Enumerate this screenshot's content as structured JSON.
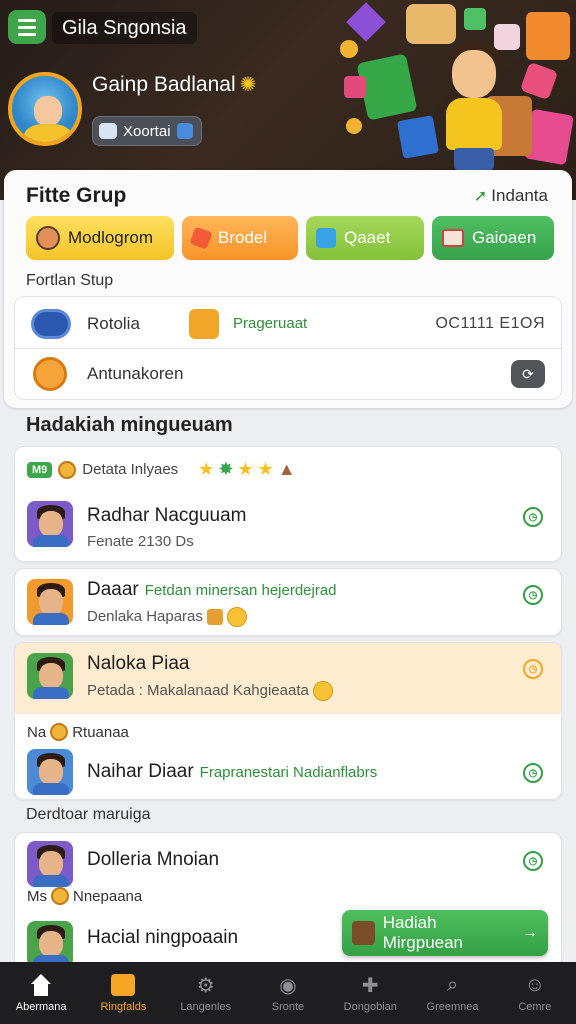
{
  "header": {
    "app_title": "Gila Sngonsia",
    "user_name": "Gainp Badlanal",
    "badge_text": "Xoortai"
  },
  "group": {
    "title": "Fitte Grup",
    "link_label": "Indanta",
    "chips": [
      {
        "label": "Modlogrom"
      },
      {
        "label": "Brodel"
      },
      {
        "label": "Qaaet"
      },
      {
        "label": "Gaioaen"
      }
    ],
    "subtitle": "Fortlan Stup",
    "row1": {
      "label": "Rotolia",
      "mid": "Prageruaat",
      "right": "OC1111 E1OЯ"
    },
    "row2": {
      "label": "Antunakoren"
    }
  },
  "weekly": {
    "title": "Hadakiah mingueuam",
    "top_tag": "M9",
    "top_label": "Detata Inlyaes",
    "items": [
      {
        "name": "Radhar Nacguuam",
        "sub": "Fenate 2130 Ds"
      },
      {
        "name": "Daaar",
        "highlight": "Fetdan minersan hejerdejrad",
        "sub": "Denlaka Haparas"
      },
      {
        "name": "Naloka Piaa",
        "sub": "Petada : Makalanaad Kahgieaata"
      },
      {
        "name": "Naihar Diaar",
        "highlight": "Frapranestari Nadianflabrs"
      }
    ],
    "mini_label": "Na",
    "mini_text": "Rtuanaa"
  },
  "section2": {
    "title": "Derdtoar maruiga",
    "items": [
      {
        "name": "Dolleria Mnoian"
      },
      {
        "name": "Hacial ningpoaain"
      }
    ],
    "mini_label": "Ms",
    "mini_text": "Nnepaana"
  },
  "cta": {
    "label": "Hadiah Mirgpuean",
    "arrow": "→"
  },
  "nav": [
    {
      "label": "Abermana"
    },
    {
      "label": "Ringfalds"
    },
    {
      "label": "Langenles"
    },
    {
      "label": "Sronte"
    },
    {
      "label": "Dongobian"
    },
    {
      "label": "Greemnea"
    },
    {
      "label": "Cemre"
    }
  ]
}
